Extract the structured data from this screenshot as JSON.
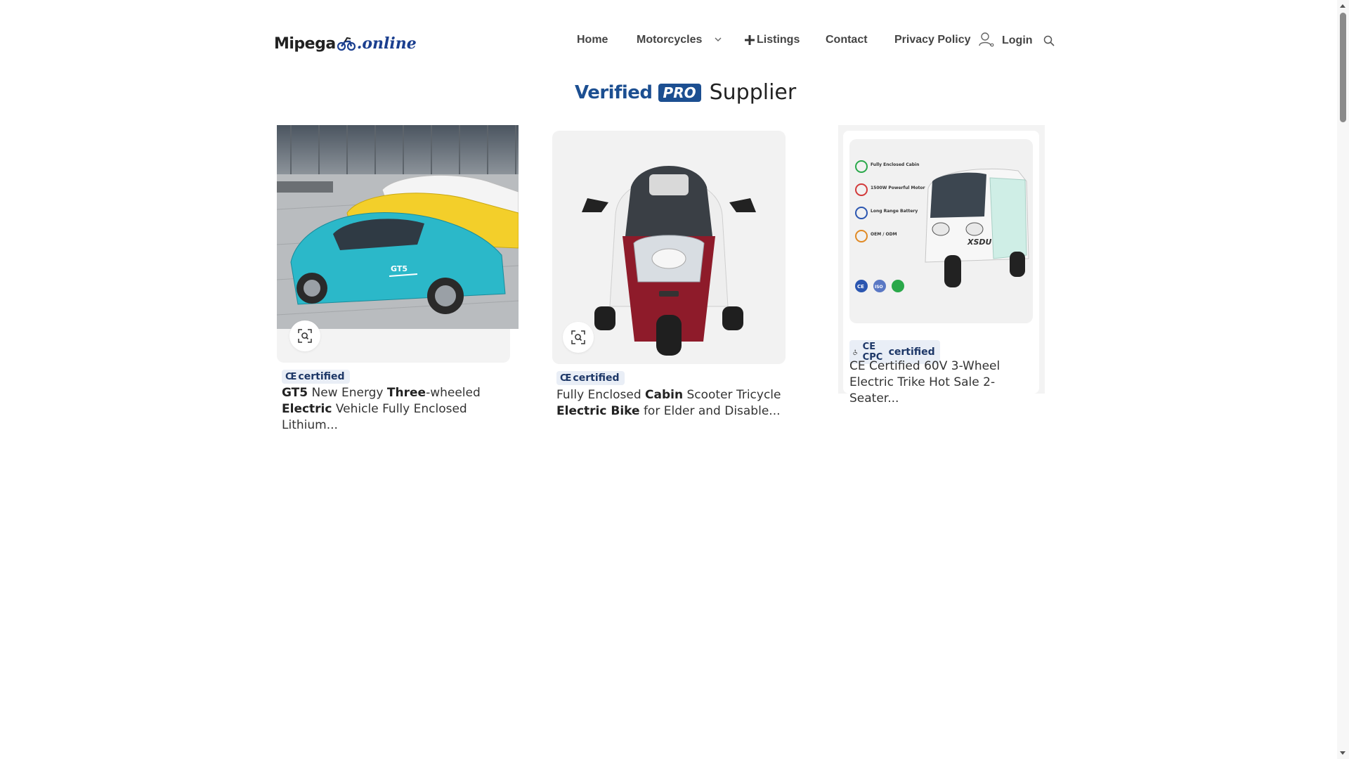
{
  "site": {
    "logo_brand": "Mipega",
    "logo_suffix": ".online"
  },
  "nav": {
    "items": [
      {
        "label": "Home",
        "icon": null
      },
      {
        "label": "Motorcycles",
        "icon": "chevron-down-icon"
      },
      {
        "label": "Listings",
        "icon": "plus-icon"
      },
      {
        "label": "Contact",
        "icon": null
      },
      {
        "label": "Privacy Policy",
        "icon": null
      },
      {
        "label": "Login",
        "icon": "user-icon"
      }
    ],
    "search_icon": "search-icon"
  },
  "heading": {
    "verified": "Verified",
    "pro": "PRO",
    "supplier": "Supplier"
  },
  "products": [
    {
      "badge": "certified",
      "badge_marks": "CE",
      "title_parts": [
        {
          "text": "GT5",
          "bold": true
        },
        {
          "text": " New Energy ",
          "bold": false
        },
        {
          "text": "Three",
          "bold": true
        },
        {
          "text": "-wheeled ",
          "bold": false
        },
        {
          "text": "Electric",
          "bold": true
        },
        {
          "text": " Vehicle Fully Enclosed Lithium...",
          "bold": false
        }
      ],
      "image_text": "GT5"
    },
    {
      "badge": "certified",
      "badge_marks": "CE",
      "title_parts": [
        {
          "text": "Fully Enclosed ",
          "bold": false
        },
        {
          "text": "Cabin",
          "bold": true
        },
        {
          "text": " Scooter Tricycle ",
          "bold": false
        },
        {
          "text": "Electric Bike",
          "bold": true
        },
        {
          "text": " for Elder and Disable...",
          "bold": false
        }
      ]
    },
    {
      "badge": "certified",
      "badge_marks": "CE CPC",
      "title_parts": [
        {
          "text": "CE Certified 60V 3-Wheel Electric Trike Hot Sale 2-Seater...",
          "bold": false
        }
      ],
      "features": [
        "Fully Enclosed Cabin",
        "1500W Powerful Motor",
        "Long Range Battery",
        "OEM / ODM"
      ],
      "cert_logos": [
        "CE",
        "ISO",
        ""
      ],
      "image_text": "XSDU"
    }
  ],
  "colors": {
    "brand_blue": "#1c4f91",
    "car_cyan": "#2bb8c9",
    "car_yellow": "#f3cf2a",
    "trike_red": "#8e1b2a"
  }
}
